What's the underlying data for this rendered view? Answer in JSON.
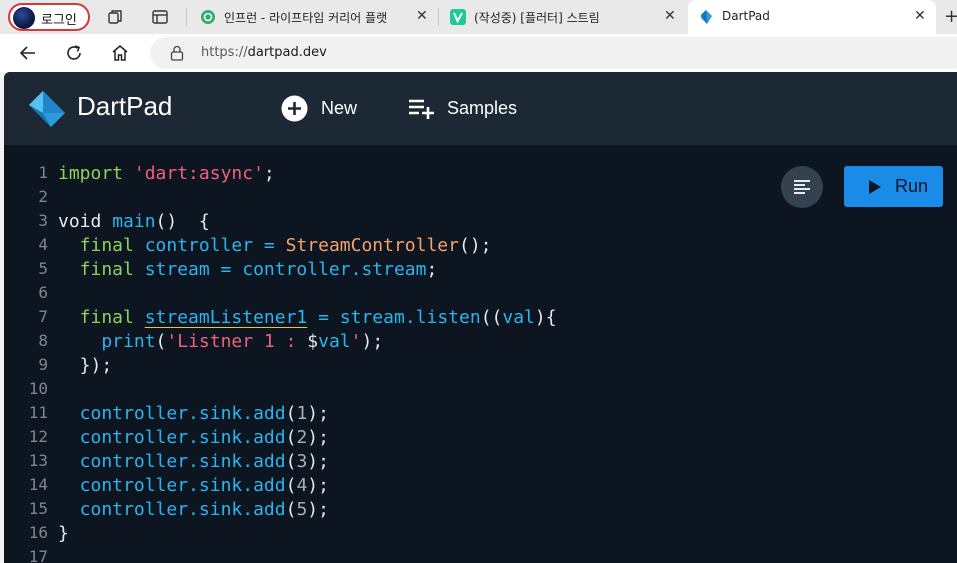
{
  "browser": {
    "profile_label": "로그인",
    "tabs": [
      {
        "title": "인프런 - 라이프타임 커리어 플랫",
        "active": false
      },
      {
        "title": "(작성중) [플러터] 스트림",
        "active": false
      },
      {
        "title": "DartPad",
        "active": true
      }
    ],
    "close_glyph": "✕",
    "new_tab_glyph": "+",
    "url_scheme": "https://",
    "url_host": "dartpad.dev"
  },
  "app": {
    "brand": "DartPad",
    "new_label": "New",
    "samples_label": "Samples",
    "run_label": "Run",
    "colors": {
      "appbar": "#1c2834",
      "editor_bg": "#0d1520",
      "run_button": "#1a8ce8",
      "keyword": "#8bd35a",
      "identifier": "#2ab5ee",
      "string": "#f0607c",
      "class": "#f4a36b"
    }
  },
  "editor": {
    "line_numbers": [
      "1",
      "2",
      "3",
      "4",
      "5",
      "6",
      "7",
      "8",
      "9",
      "10",
      "11",
      "12",
      "13",
      "14",
      "15",
      "16",
      "17"
    ],
    "lines": {
      "l1": {
        "kw": "import",
        "str": " 'dart:async'",
        "end": ";"
      },
      "l3": {
        "a": "void ",
        "b": "main",
        "c": "()  {"
      },
      "l4": {
        "kw": "  final",
        "id": " controller",
        "eq": " = ",
        "cls": "StreamController",
        "end": "();"
      },
      "l5": {
        "kw": "  final",
        "id": " stream",
        "eq": " = ",
        "id2": "controller",
        "dot": ".",
        "id3": "stream",
        "end": ";"
      },
      "l7": {
        "kw": "  final",
        "sp": " ",
        "id": "streamListener1",
        "eq": " = ",
        "id2": "stream",
        "dot": ".",
        "id3": "listen",
        "p1": "((",
        "id4": "val",
        "p2": "){"
      },
      "l8": {
        "id": "    print",
        "p1": "(",
        "str": "'Listner 1 : ",
        "dollar": "$",
        "id2": "val",
        "str2": "'",
        "end": ");"
      },
      "l9": {
        "a": "  });"
      },
      "l11": {
        "id": "  controller",
        "dot": ".",
        "id2": "sink",
        "dot2": ".",
        "id3": "add",
        "p1": "(",
        "num": "1",
        "end": ");"
      },
      "l12": {
        "id": "  controller",
        "dot": ".",
        "id2": "sink",
        "dot2": ".",
        "id3": "add",
        "p1": "(",
        "num": "2",
        "end": ");"
      },
      "l13": {
        "id": "  controller",
        "dot": ".",
        "id2": "sink",
        "dot2": ".",
        "id3": "add",
        "p1": "(",
        "num": "3",
        "end": ");"
      },
      "l14": {
        "id": "  controller",
        "dot": ".",
        "id2": "sink",
        "dot2": ".",
        "id3": "add",
        "p1": "(",
        "num": "4",
        "end": ");"
      },
      "l15": {
        "id": "  controller",
        "dot": ".",
        "id2": "sink",
        "dot2": ".",
        "id3": "add",
        "p1": "(",
        "num": "5",
        "end": ");"
      },
      "l16": {
        "a": "}"
      }
    }
  }
}
